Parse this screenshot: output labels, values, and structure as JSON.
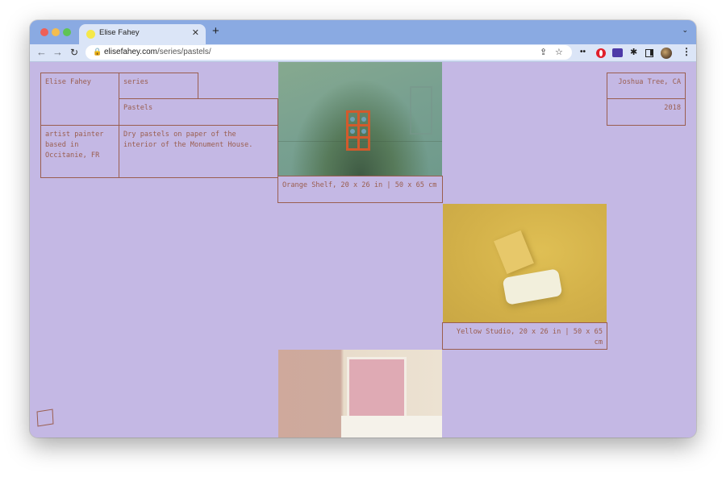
{
  "browser": {
    "tab_title": "Elise Fahey",
    "url_host": "elisefahey.com",
    "url_path": "/series/pastels/",
    "icons": {
      "back": "←",
      "forward": "→",
      "reload": "↻",
      "lock": "🔒",
      "share": "⇪",
      "star": "☆",
      "close": "✕",
      "new_tab": "+",
      "tab_menu": "⌄",
      "dots": "••",
      "puzzle": "✱",
      "kebab": "⋮"
    }
  },
  "site": {
    "name": "Elise Fahey",
    "series_label": "series",
    "series_name": "Pastels",
    "bio": "artist painter based in Occitanie, FR",
    "description": "Dry pastels on paper of the interior of the Monument House.",
    "location": "Joshua Tree, CA",
    "year": "2018"
  },
  "works": [
    {
      "caption": "Orange Shelf, 20 x 26 in | 50 x 65 cm"
    },
    {
      "caption": "Yellow Studio, 20 x 26 in | 50 x 65 cm"
    },
    {
      "caption": ""
    }
  ],
  "colors": {
    "page_background": "#c4b8e4",
    "ink": "#9a5e4f",
    "tab_strip": "#8aaae2"
  }
}
